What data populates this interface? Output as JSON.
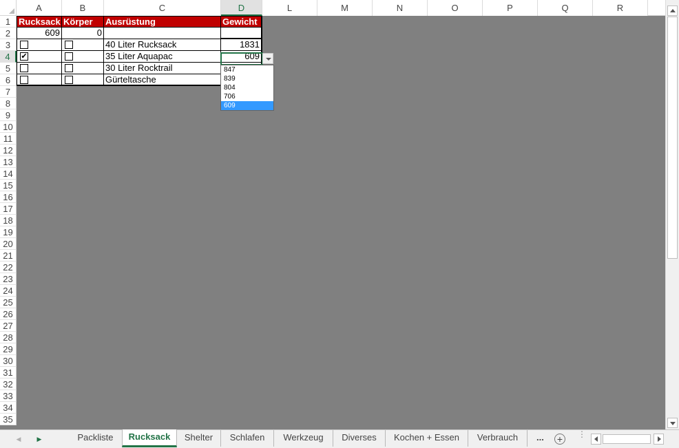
{
  "columns": [
    "A",
    "B",
    "C",
    "D",
    "L",
    "M",
    "N",
    "O",
    "P",
    "Q",
    "R"
  ],
  "rows": [
    "1",
    "2",
    "3",
    "4",
    "5",
    "6",
    "7",
    "8",
    "9",
    "10",
    "11",
    "12",
    "13",
    "14",
    "15",
    "16",
    "17",
    "18",
    "19",
    "20",
    "21",
    "22",
    "23",
    "24",
    "25",
    "26",
    "27",
    "28",
    "29",
    "30",
    "31",
    "32",
    "33",
    "34",
    "35"
  ],
  "table": {
    "headers": [
      "Rucksack",
      "Körper",
      "Ausrüstung",
      "Gewicht"
    ],
    "totals": {
      "rucksack": "609",
      "koerper": "0"
    },
    "items": [
      {
        "rucksack_checked": false,
        "koerper_checked": false,
        "label": "40 Liter Rucksack",
        "weight": "1831"
      },
      {
        "rucksack_checked": true,
        "koerper_checked": false,
        "label": "35 Liter Aquapac",
        "weight": "609"
      },
      {
        "rucksack_checked": false,
        "koerper_checked": false,
        "label": "30 Liter Rocktrail",
        "weight": ""
      },
      {
        "rucksack_checked": false,
        "koerper_checked": false,
        "label": "Gürteltasche",
        "weight": ""
      }
    ]
  },
  "dropdown": {
    "options": [
      "847",
      "839",
      "804",
      "706",
      "609"
    ],
    "selected": "609"
  },
  "checkbox_glyph": "✔",
  "sheet_tabs": [
    "Packliste",
    "Rucksack",
    "Shelter",
    "Schlafen",
    "Werkzeug",
    "Diverses",
    "Kochen + Essen",
    "Verbrauch"
  ],
  "active_tab": "Rucksack",
  "more_tabs_label": "...",
  "colors": {
    "header_fill": "#c00000",
    "accent_green": "#217346",
    "grid_background": "#808080",
    "selection_blue": "#3399ff"
  }
}
